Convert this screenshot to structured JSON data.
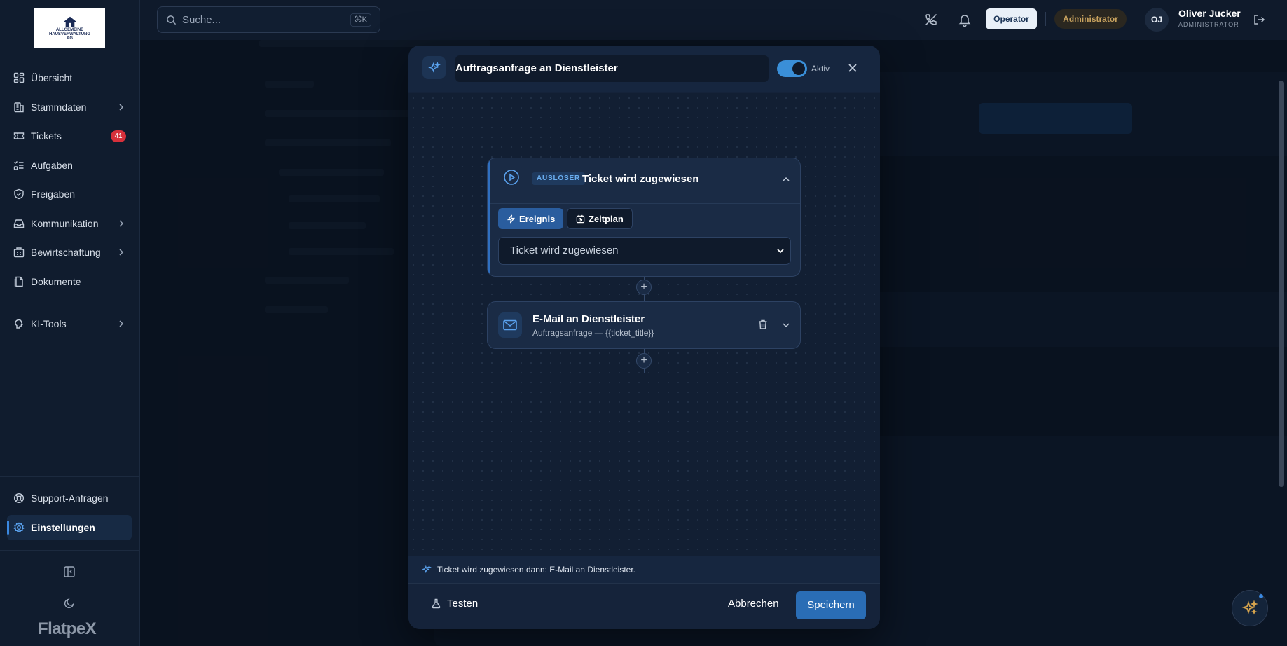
{
  "sidebar": {
    "logo_lines": [
      "ALLGEMEINE",
      "HAUSVERWALTUNG",
      "AG"
    ],
    "items": [
      {
        "label": "Übersicht",
        "icon": "dashboard-icon"
      },
      {
        "label": "Stammdaten",
        "icon": "building-icon",
        "has_chevron": true
      },
      {
        "label": "Tickets",
        "icon": "ticket-icon",
        "badge": "41"
      },
      {
        "label": "Aufgaben",
        "icon": "list-check-icon"
      },
      {
        "label": "Freigaben",
        "icon": "shield-check-icon"
      },
      {
        "label": "Kommunikation",
        "icon": "inbox-icon",
        "has_chevron": true
      },
      {
        "label": "Bewirtschaftung",
        "icon": "building-icon",
        "has_chevron": true
      },
      {
        "label": "Dokumente",
        "icon": "document-icon"
      },
      {
        "label": "KI-Tools",
        "icon": "brain-icon",
        "has_chevron": true
      }
    ],
    "support_label": "Support-Anfragen",
    "settings_label": "Einstellungen",
    "brand": "FlatpeX"
  },
  "header": {
    "search_placeholder": "Suche...",
    "search_shortcut": "⌘K",
    "operator_label": "Operator",
    "admin_label": "Administrator",
    "avatar_initials": "OJ",
    "user_name": "Oliver Jucker",
    "user_role": "ADMINISTRATOR"
  },
  "modal": {
    "title": "Auftragsanfrage an Dienstleister",
    "toggle_label": "Aktiv",
    "toggle_on": true,
    "trigger": {
      "pill": "AUSLÖSER",
      "title": "Ticket wird zugewiesen",
      "tab_event": "Ereignis",
      "tab_schedule": "Zeitplan",
      "selected_event": "Ticket wird zugewiesen"
    },
    "action": {
      "title": "E-Mail an Dienstleister",
      "subtitle": "Auftragsanfrage — {{ticket_title}}"
    },
    "summary": "Ticket wird zugewiesen dann: E-Mail an Dienstleister.",
    "test_label": "Testen",
    "cancel_label": "Abbrechen",
    "save_label": "Speichern"
  },
  "colors": {
    "accent": "#2a6db5",
    "badge_red": "#d7303b",
    "admin_gold": "#c9a35f",
    "toggle": "#3a8fd8"
  }
}
